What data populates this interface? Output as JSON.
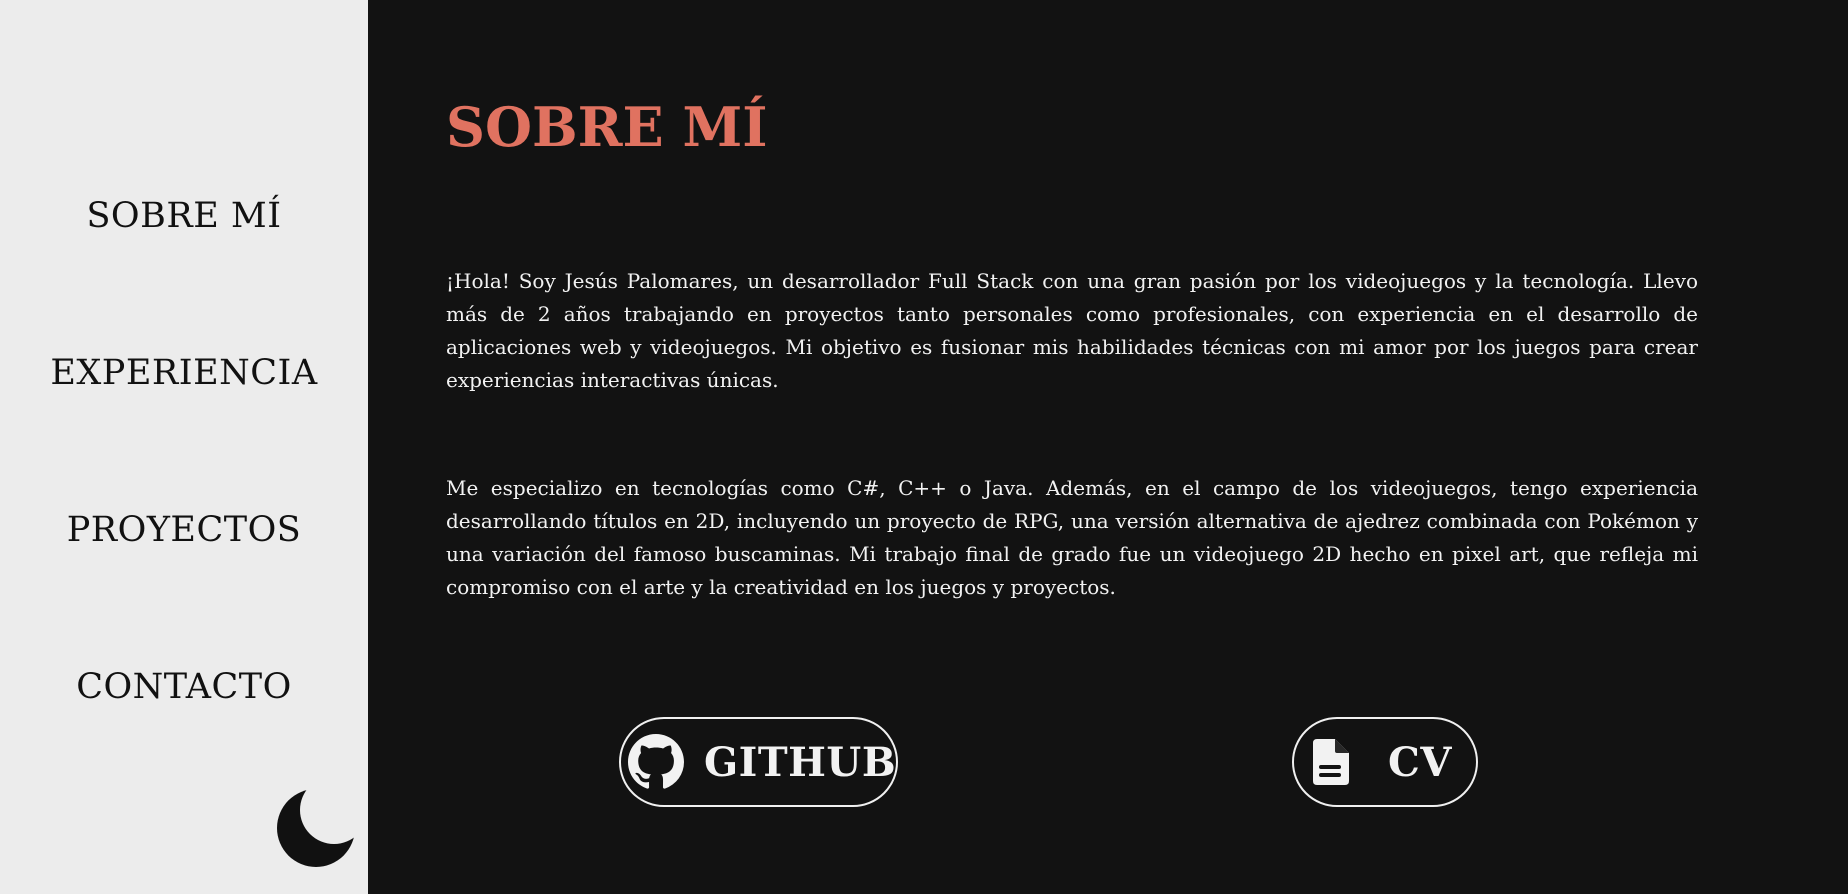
{
  "sidebar": {
    "items": [
      {
        "label": "SOBRE MÍ"
      },
      {
        "label": "EXPERIENCIA"
      },
      {
        "label": "PROYECTOS"
      },
      {
        "label": "CONTACTO"
      }
    ],
    "theme_toggle_icon": "moon-icon"
  },
  "main": {
    "title": "SOBRE MÍ",
    "paragraphs": [
      "¡Hola! Soy Jesús Palomares, un desarrollador Full Stack con una gran pasión por los videojuegos y la tecnología. Llevo más de 2 años trabajando en proyectos tanto personales como profesionales, con experiencia en el desarrollo de aplicaciones web y videojuegos. Mi objetivo es fusionar mis habilidades técnicas con mi amor por los juegos para crear experiencias interactivas únicas.",
      "Me especializo en tecnologías como C#, C++ o Java. Además, en el campo de los videojuegos, tengo experiencia desarrollando títulos en 2D, incluyendo un proyecto de RPG, una versión alternativa de ajedrez combinada con Pokémon y una variación del famoso buscaminas. Mi trabajo final de grado fue un videojuego 2D hecho en pixel art, que refleja mi compromiso con el arte y la creatividad en los juegos y proyectos."
    ],
    "buttons": {
      "github": {
        "label": "GITHUB",
        "icon": "github-icon"
      },
      "cv": {
        "label": "CV",
        "icon": "document-icon"
      }
    }
  },
  "colors": {
    "sidebar_bg": "#ececec",
    "main_bg": "#121212",
    "accent": "#e07260",
    "text_light": "#f2f2f2",
    "text_dark": "#111111"
  }
}
